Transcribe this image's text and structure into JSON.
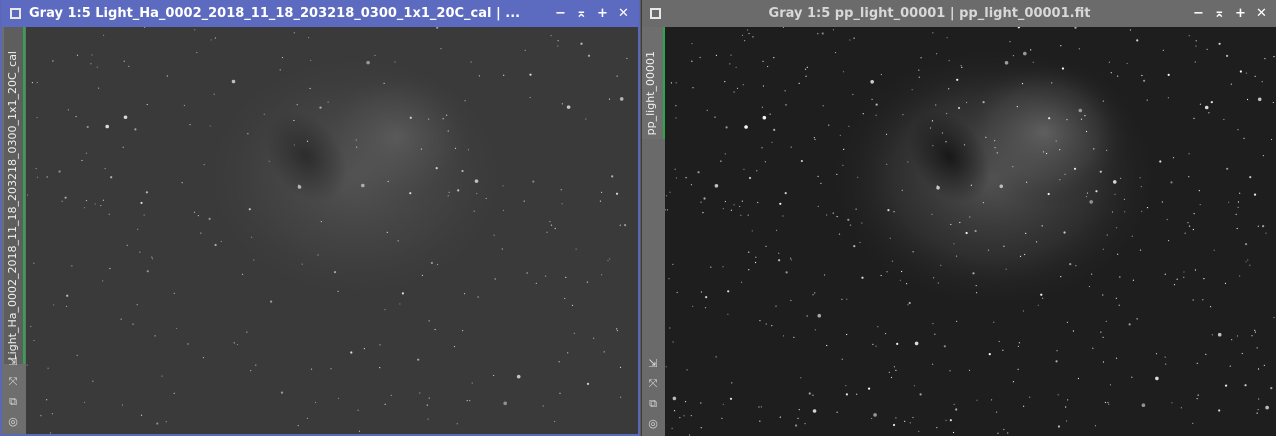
{
  "left_window": {
    "title": "Gray 1:5 Light_Ha_0002_2018_11_18_203218_0300_1x1_20C_cal | ...",
    "tab_label": "Light_Ha_0002_2018_11_18_203218_0300_1x1_20C_cal",
    "colors": {
      "titlebar": "#5c6bc0",
      "accent": "#2ea64a",
      "background": "#3a3a3a"
    }
  },
  "right_window": {
    "title": "Gray 1:5 pp_light_00001 | pp_light_00001.fit",
    "tab_label": "pp_light_00001",
    "colors": {
      "titlebar": "#6b6b6b",
      "accent": "#2ea64a",
      "background": "#1e1e1e"
    }
  },
  "title_buttons": {
    "minimize": "−",
    "shade": "⌅",
    "maximize": "+",
    "close": "✕"
  },
  "side_icons": {
    "fit": "⇲",
    "zoom": "⤧",
    "clone": "⧉",
    "settings": "◎"
  }
}
